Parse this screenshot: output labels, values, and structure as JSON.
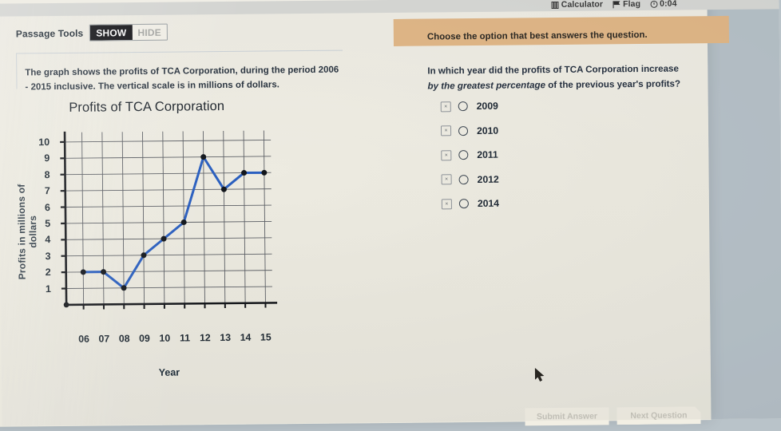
{
  "topbar": {
    "calculator_label": "Calculator",
    "flag_label": "Flag",
    "timer": "0:04",
    "calculator_icon": "calculator-icon",
    "flag_icon": "flag-icon",
    "clock_icon": "clock-icon"
  },
  "passage_tools": {
    "label": "Passage Tools",
    "show_label": "SHOW",
    "hide_label": "HIDE",
    "active": "SHOW"
  },
  "passage": {
    "text": "The graph shows the profits of TCA Corporation, during the period 2006 - 2015 inclusive.  The vertical scale is in millions of dollars."
  },
  "banner": {
    "text": "Choose the option that best answers the question."
  },
  "question": {
    "part1": "In which year did the profits of TCA Corporation increase ",
    "em1": "by the greatest percentage",
    "part2": " of the previous year's profits?"
  },
  "options": [
    {
      "label": "2009",
      "cross_mark": "×",
      "selected": false
    },
    {
      "label": "2010",
      "cross_mark": "×",
      "selected": false
    },
    {
      "label": "2011",
      "cross_mark": "×",
      "selected": false
    },
    {
      "label": "2012",
      "cross_mark": "×",
      "selected": false
    },
    {
      "label": "2014",
      "cross_mark": "×",
      "selected": false
    }
  ],
  "footer": {
    "submit_label": "Submit Answer",
    "next_label": "Next Question"
  },
  "colors": {
    "banner": "#e2b888",
    "line": "#2a5fc0",
    "marker": "#12161c",
    "page": "#efece3",
    "outer": "#b7c2c9"
  },
  "chart_data": {
    "type": "line",
    "title": "Profits of TCA Corporation",
    "xlabel": "Year",
    "ylabel": "Profits in millions of dollars",
    "categories": [
      "06",
      "07",
      "08",
      "09",
      "10",
      "11",
      "12",
      "13",
      "14",
      "15"
    ],
    "x_full_years": [
      2006,
      2007,
      2008,
      2009,
      2010,
      2011,
      2012,
      2013,
      2014,
      2015
    ],
    "values": [
      2,
      2,
      1,
      3,
      4,
      5,
      9,
      7,
      8,
      8
    ],
    "ylim": [
      0,
      10
    ],
    "yticks": [
      1,
      2,
      3,
      4,
      5,
      6,
      7,
      8,
      9,
      10
    ],
    "grid": true,
    "legend": false,
    "units": "millions of dollars"
  }
}
